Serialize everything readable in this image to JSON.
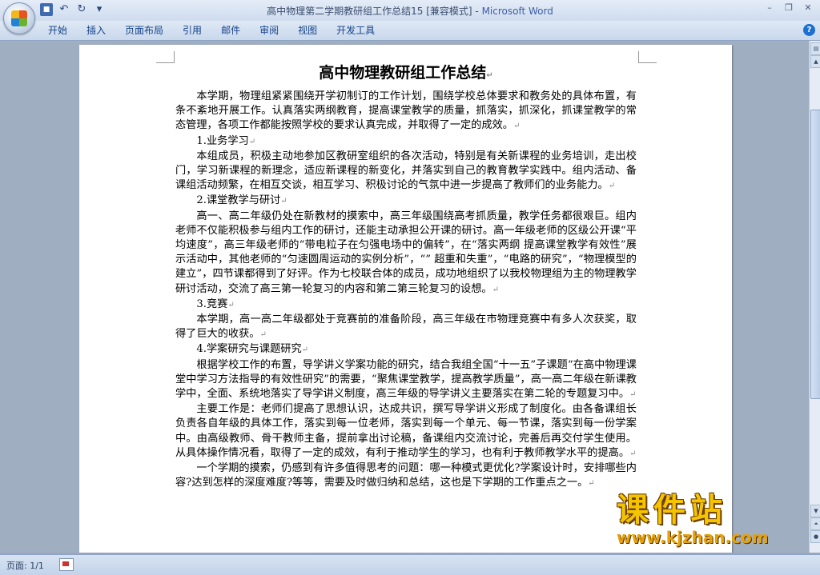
{
  "window": {
    "title_doc": "高中物理第二学期教研组工作总结15 [兼容模式] - ",
    "title_app": "Microsoft Word"
  },
  "ribbon": {
    "tabs": [
      "开始",
      "插入",
      "页面布局",
      "引用",
      "邮件",
      "审阅",
      "视图",
      "开发工具"
    ]
  },
  "document": {
    "title": "高中物理教研组工作总结",
    "paragraphs": [
      {
        "text": "本学期，物理组紧紧围绕开学初制订的工作计划，围绕学校总体要求和教务处的具体布置，有条不紊地开展工作。认真落实两纲教育，提高课堂教学的质量，抓落实，抓深化，抓课堂教学的常态管理，各项工作都能按照学校的要求认真完成，并取得了一定的成效。",
        "head": false
      },
      {
        "text": "1.业务学习",
        "head": true
      },
      {
        "text": "本组成员，积极主动地参加区教研室组织的各次活动，特别是有关新课程的业务培训，走出校门，学习新课程的新理念，适应新课程的新变化，并落实到自己的教育教学实践中。组内活动、备课组活动频繁，在相互交谈，相互学习、积极讨论的气氛中进一步提高了教师们的业务能力。",
        "head": false
      },
      {
        "text": "2.课堂教学与研讨",
        "head": true
      },
      {
        "text": "高一、高二年级仍处在新教材的摸索中，高三年级围绕高考抓质量，教学任务都很艰巨。组内老师不仅能积极参与组内工作的研讨，还能主动承担公开课的研讨。高一年级老师的区级公开课“平均速度”，高三年级老师的“带电粒子在匀强电场中的偏转”，在“落实两纲 提高课堂教学有效性”展示活动中，其他老师的“匀速圆周运动的实例分析”，“” 超重和失重”，“电路的研究”，“物理模型的建立”，四节课都得到了好评。作为七校联合体的成员，成功地组织了以我校物理组为主的物理教学研讨活动，交流了高三第一轮复习的内容和第二第三轮复习的设想。",
        "head": false
      },
      {
        "text": "3.竞赛",
        "head": true
      },
      {
        "text": "本学期，高一高二年级都处于竞赛前的准备阶段，高三年级在市物理竞赛中有多人次获奖，取得了巨大的收获。",
        "head": false
      },
      {
        "text": "4.学案研究与课题研究",
        "head": true
      },
      {
        "text": "根据学校工作的布置，导学讲义学案功能的研究，结合我组全国“十一五”子课题“在高中物理课堂中学习方法指导的有效性研究”的需要，“聚焦课堂教学，提高教学质量”，高一高二年级在新课教学中，全面、系统地落实了导学讲义制度，高三年级的导学讲义主要落实在第二轮的专题复习中。",
        "head": false
      },
      {
        "text": "主要工作是：老师们提高了思想认识，达成共识，撰写导学讲义形成了制度化。由各备课组长负责各自年级的具体工作，落实到每一位老师，落实到每一个单元、每一节课，落实到每一份学案中。由高级教师、骨干教师主备，提前拿出讨论稿，备课组内交流讨论，完善后再交付学生使用。从具体操作情况看，取得了一定的成效，有利于推动学生的学习，也有利于教师教学水平的提高。",
        "head": false
      },
      {
        "text": "一个学期的摸索，仍感到有许多值得思考的问题：哪一种模式更优化?学案设计时，安排哪些内容?达到怎样的深度难度?等等，需要及时做归纳和总结，这也是下学期的工作重点之一。",
        "head": false
      }
    ]
  },
  "status": {
    "page": "页面: 1/1"
  },
  "watermark": {
    "title": "课件站",
    "url": "www.kjzhan.com"
  }
}
